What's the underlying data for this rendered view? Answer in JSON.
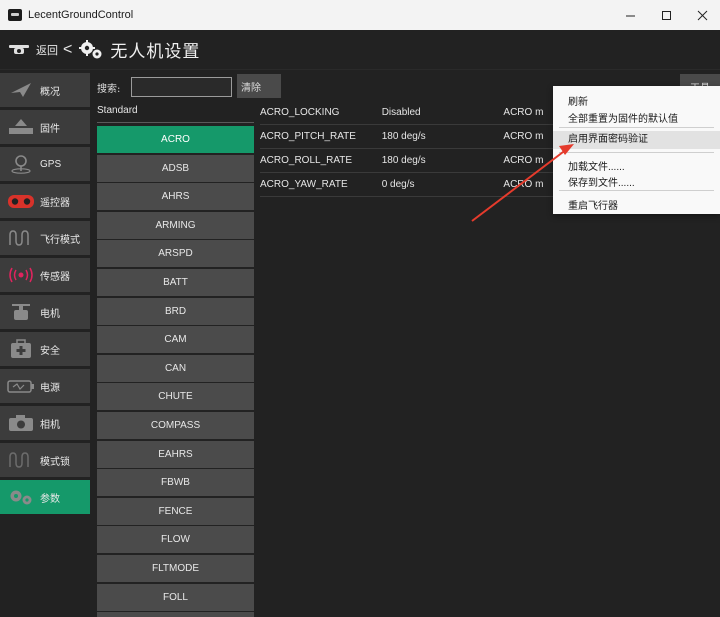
{
  "window": {
    "title": "LecentGroundControl",
    "minimize": "–",
    "maximize": "☐",
    "close": "✕"
  },
  "header": {
    "back_label": "返回",
    "back_caret": "<",
    "title": "无人机设置"
  },
  "sidebar": {
    "items": [
      {
        "label": "概况",
        "icon": "plane-icon"
      },
      {
        "label": "固件",
        "icon": "firmware-icon"
      },
      {
        "label": "GPS",
        "icon": "gps-pin-icon"
      },
      {
        "label": "遥控器",
        "icon": "remote-control-icon"
      },
      {
        "label": "飞行模式",
        "icon": "wave-icon"
      },
      {
        "label": "传感器",
        "icon": "sensor-icon"
      },
      {
        "label": "电机",
        "icon": "motor-icon"
      },
      {
        "label": "安全",
        "icon": "safety-icon"
      },
      {
        "label": "电源",
        "icon": "battery-icon"
      },
      {
        "label": "相机",
        "icon": "camera-icon"
      },
      {
        "label": "模式锁",
        "icon": "mode-lock-icon"
      },
      {
        "label": "参数",
        "icon": "gears-icon"
      }
    ],
    "active_index": 11
  },
  "toolbar": {
    "search_label": "搜索:",
    "search_value": "",
    "clear_label": "清除",
    "tools_label": "工具"
  },
  "groups": {
    "header": "Standard",
    "items": [
      "ACRO",
      "ADSB",
      "AHRS",
      "ARMING",
      "ARSPD",
      "BATT",
      "BRD",
      "CAM",
      "CAN",
      "CHUTE",
      "COMPASS",
      "EAHRS",
      "FBWB",
      "FENCE",
      "FLOW",
      "FLTMODE",
      "FOLL",
      ""
    ],
    "active_index": 0
  },
  "params": {
    "rows": [
      {
        "name": "ACRO_LOCKING",
        "value": "Disabled",
        "desc": "ACRO m"
      },
      {
        "name": "ACRO_PITCH_RATE",
        "value": "180 deg/s",
        "desc": "ACRO m"
      },
      {
        "name": "ACRO_ROLL_RATE",
        "value": "180 deg/s",
        "desc": "ACRO m"
      },
      {
        "name": "ACRO_YAW_RATE",
        "value": "0 deg/s",
        "desc": "ACRO m"
      }
    ]
  },
  "context_menu": {
    "items": [
      {
        "label": "刷新"
      },
      {
        "label": "全部重置为固件的默认值"
      },
      {
        "label": "启用界面密码验证",
        "highlighted": true
      },
      {
        "label": "加载文件......"
      },
      {
        "label": "保存到文件......"
      },
      {
        "label": "重启飞行器"
      }
    ]
  },
  "colors": {
    "accent": "#15996a",
    "sidebar_bg": "#3c3c3c",
    "background": "#222222",
    "annotation_arrow": "#e53b2c"
  }
}
